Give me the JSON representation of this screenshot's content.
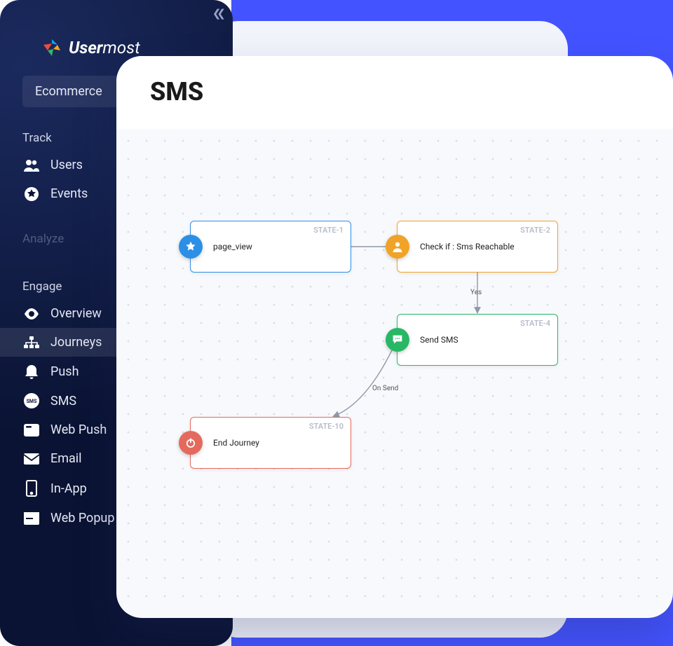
{
  "brand": {
    "prefix": "User",
    "suffix": "most"
  },
  "workspace": "Ecommerce",
  "sections": {
    "track": "Track",
    "analyze": "Analyze",
    "engage": "Engage"
  },
  "nav": {
    "users": "Users",
    "events": "Events",
    "overview": "Overview",
    "journeys": "Journeys",
    "push": "Push",
    "sms": "SMS",
    "webpush": "Web Push",
    "email": "Email",
    "inapp": "In-App",
    "webpopup": "Web Popup"
  },
  "canvas": {
    "title": "SMS",
    "nodes": {
      "state1": {
        "id": "STATE-1",
        "label": "page_view"
      },
      "state2": {
        "id": "STATE-2",
        "label": "Check if : Sms Reachable"
      },
      "state4": {
        "id": "STATE-4",
        "label": "Send SMS"
      },
      "state10": {
        "id": "STATE-10",
        "label": "End Journey"
      }
    },
    "edges": {
      "e1": "Yes",
      "e2": "On Send"
    }
  }
}
